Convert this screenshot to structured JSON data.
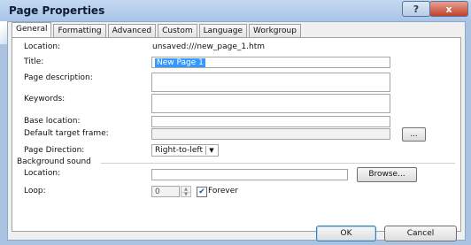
{
  "window": {
    "title": "Page Properties",
    "help_label": "?",
    "close_label": "x"
  },
  "tabs": [
    {
      "label": "General"
    },
    {
      "label": "Formatting"
    },
    {
      "label": "Advanced"
    },
    {
      "label": "Custom"
    },
    {
      "label": "Language"
    },
    {
      "label": "Workgroup"
    }
  ],
  "general": {
    "location_label": "Location:",
    "location_value": "unsaved:///new_page_1.htm",
    "title_label": "Title:",
    "title_value": "New Page 1",
    "page_description_label": "Page description:",
    "keywords_label": "Keywords:",
    "base_location_label": "Base location:",
    "default_target_frame_label": "Default target frame:",
    "target_frame_button_label": "...",
    "page_direction_label": "Page Direction:",
    "page_direction_value": "Right-to-left"
  },
  "background_sound": {
    "group_label": "Background sound",
    "location_label": "Location:",
    "browse_label": "Browse...",
    "loop_label": "Loop:",
    "loop_value": "0",
    "forever_label": "Forever",
    "forever_checked": true
  },
  "footer": {
    "ok_label": "OK",
    "cancel_label": "Cancel"
  }
}
